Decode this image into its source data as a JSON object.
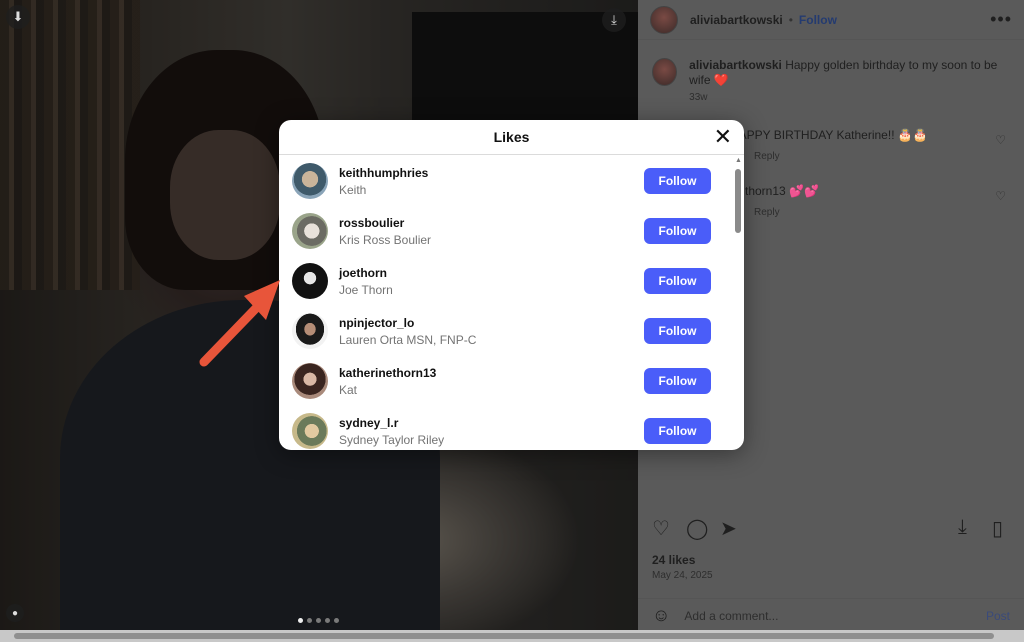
{
  "post": {
    "author": "aliviabartkowski",
    "follow_label": "Follow",
    "more_icon": "more-icon",
    "caption_author": "aliviabartkowski",
    "caption_text": "Happy golden birthday to my soon to be wife ❤️",
    "caption_time": "33w",
    "comments": [
      {
        "text": "a HAPPY BIRTHDAY Katherine!! 🎂🎂",
        "reply": "Reply"
      },
      {
        "text": "thorn13 💕💕",
        "reply": "Reply"
      }
    ],
    "likes": "24 likes",
    "date": "May 24, 2025",
    "add_comment_placeholder": "Add a comment...",
    "post_label": "Post"
  },
  "modal": {
    "title": "Likes",
    "users": [
      {
        "username": "keithhumphries",
        "name": "Keith",
        "button": "Follow"
      },
      {
        "username": "rossboulier",
        "name": "Kris Ross Boulier",
        "button": "Follow"
      },
      {
        "username": "joethorn",
        "name": "Joe Thorn",
        "button": "Follow"
      },
      {
        "username": "npinjector_lo",
        "name": "Lauren Orta MSN, FNP-C",
        "button": "Follow"
      },
      {
        "username": "katherinethorn13",
        "name": "Kat",
        "button": "Follow"
      },
      {
        "username": "sydney_l.r",
        "name": "Sydney Taylor Riley",
        "button": "Follow"
      }
    ]
  },
  "colors": {
    "follow_button": "#4a5df9",
    "arrow": "#e8553a"
  }
}
